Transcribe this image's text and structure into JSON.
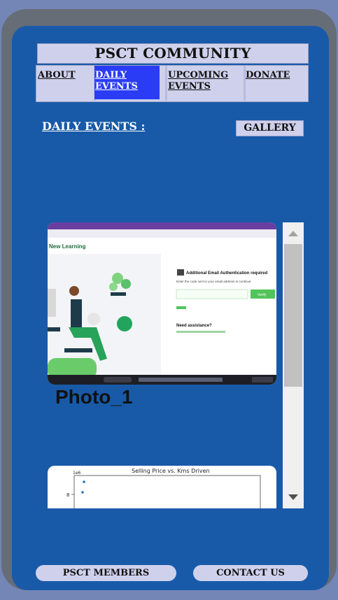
{
  "header": {
    "title": "PSCT COMMUNITY"
  },
  "nav": {
    "about": "ABOUT",
    "daily_l1": "DAILY",
    "daily_l2": "EVENTS",
    "upcoming_l1": "UPCOMING",
    "upcoming_l2": "EVENTS",
    "donate": "DONATE"
  },
  "section": {
    "title": "DAILY EVENTS :",
    "gallery": "GALLERY"
  },
  "photo1": {
    "caption": "Photo_1",
    "brand": "New Learning",
    "auth_title": "Additional Email Authentication required",
    "auth_sub": "Enter the code sent to your email address to continue",
    "verify": "Verify",
    "assist": "Need assistance?"
  },
  "photo2": {
    "title": "Selling Price vs. Kms Driven",
    "scale": "1e6",
    "ytick": "8"
  },
  "footer": {
    "members": "PSCT MEMBERS",
    "contact": "CONTACT US"
  },
  "colors": {
    "active_tab": "#2a3cf5",
    "panel": "#cfd1ec",
    "screen": "#185aa8"
  }
}
